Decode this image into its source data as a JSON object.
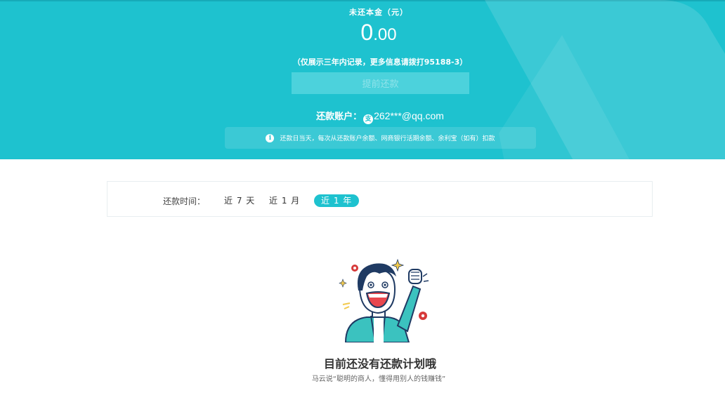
{
  "header": {
    "amount_label": "未还本金（元）",
    "amount_int": "0",
    "amount_dec": ".00",
    "note": "（仅展示三年内记录，更多信息请拨打95188-3）",
    "prepay_button": "提前还款",
    "account_label": "还款账户：",
    "account_value": "262***@qq.com",
    "alipay_icon_glyph": "支",
    "tip_text": "还款日当天，每次从还款账户余额、网商银行活期余额、余利宝（如有）扣款",
    "info_icon_glyph": "i",
    "accent_color": "#1ec2cf"
  },
  "filter": {
    "label": "还款时间：",
    "options": [
      "近 7 天",
      "近 1 月",
      "近 1 年"
    ],
    "selected": "近 1 年"
  },
  "empty_state": {
    "illustration": "cheering-man-illustration",
    "title": "目前还没有还款计划哦",
    "subtitle": "马云说“聪明的商人，懂得用别人的钱赚钱”"
  }
}
